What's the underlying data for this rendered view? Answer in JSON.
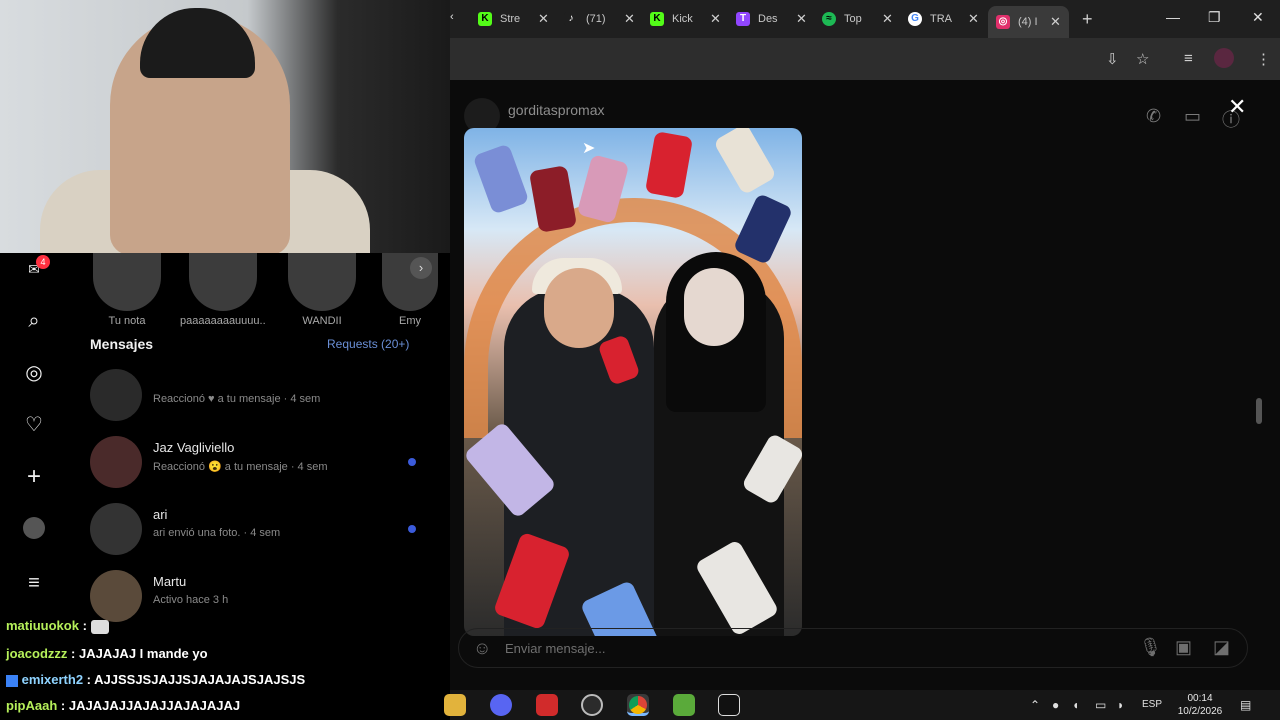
{
  "browser": {
    "tabs": [
      {
        "title": "Stre",
        "icon": "kick-icon",
        "color": "#53fc18"
      },
      {
        "title": "(71)",
        "icon": "tiktok-icon",
        "color": "#ffffff"
      },
      {
        "title": "Kick",
        "icon": "kick-icon",
        "color": "#53fc18"
      },
      {
        "title": "Des",
        "icon": "twitch-icon",
        "color": "#9146ff"
      },
      {
        "title": "Top",
        "icon": "spotify-icon",
        "color": "#1db954"
      },
      {
        "title": "TRA",
        "icon": "google-icon",
        "color": "#ffffff"
      },
      {
        "title": "(4) I",
        "icon": "instagram-icon",
        "color": "#e1306c"
      }
    ]
  },
  "instagram": {
    "stories": [
      {
        "label": "Tu nota"
      },
      {
        "label": "paaaaaaaauuuu..."
      },
      {
        "label": "WANDII"
      },
      {
        "label": "Emy"
      }
    ],
    "notification_badge": "4",
    "messages_heading": "Mensajes",
    "requests_label": "Requests (20+)",
    "conversations": [
      {
        "name": "",
        "preview": "Reaccionó ♥ a tu mensaje · 4 sem",
        "unread": false
      },
      {
        "name": "Jaz Vagliviello",
        "preview": "Reaccionó 😮 a tu mensaje · 4 sem",
        "unread": true
      },
      {
        "name": "ari",
        "preview": "ari envió una foto. · 4 sem",
        "unread": true
      },
      {
        "name": "Martu",
        "preview": "Activo hace 3 h",
        "unread": false
      }
    ],
    "chat": {
      "username": "gorditaspromax",
      "composer_placeholder": "Enviar mensaje..."
    }
  },
  "stream_chat": [
    {
      "user": "matiuuokok",
      "message": ""
    },
    {
      "user": "joacodzzz",
      "message": "JAJAJAJ I mande yo"
    },
    {
      "user": "emixerth2",
      "message": "AJJSSJSJAJJSJAJAJAJSJAJSJS"
    },
    {
      "user": "pipAaah",
      "message": "JAJAJAJJAJAJJAJAJAJAJ"
    }
  ],
  "taskbar": {
    "language": "ESP",
    "time": "00:14",
    "date": "10/2/2026"
  }
}
